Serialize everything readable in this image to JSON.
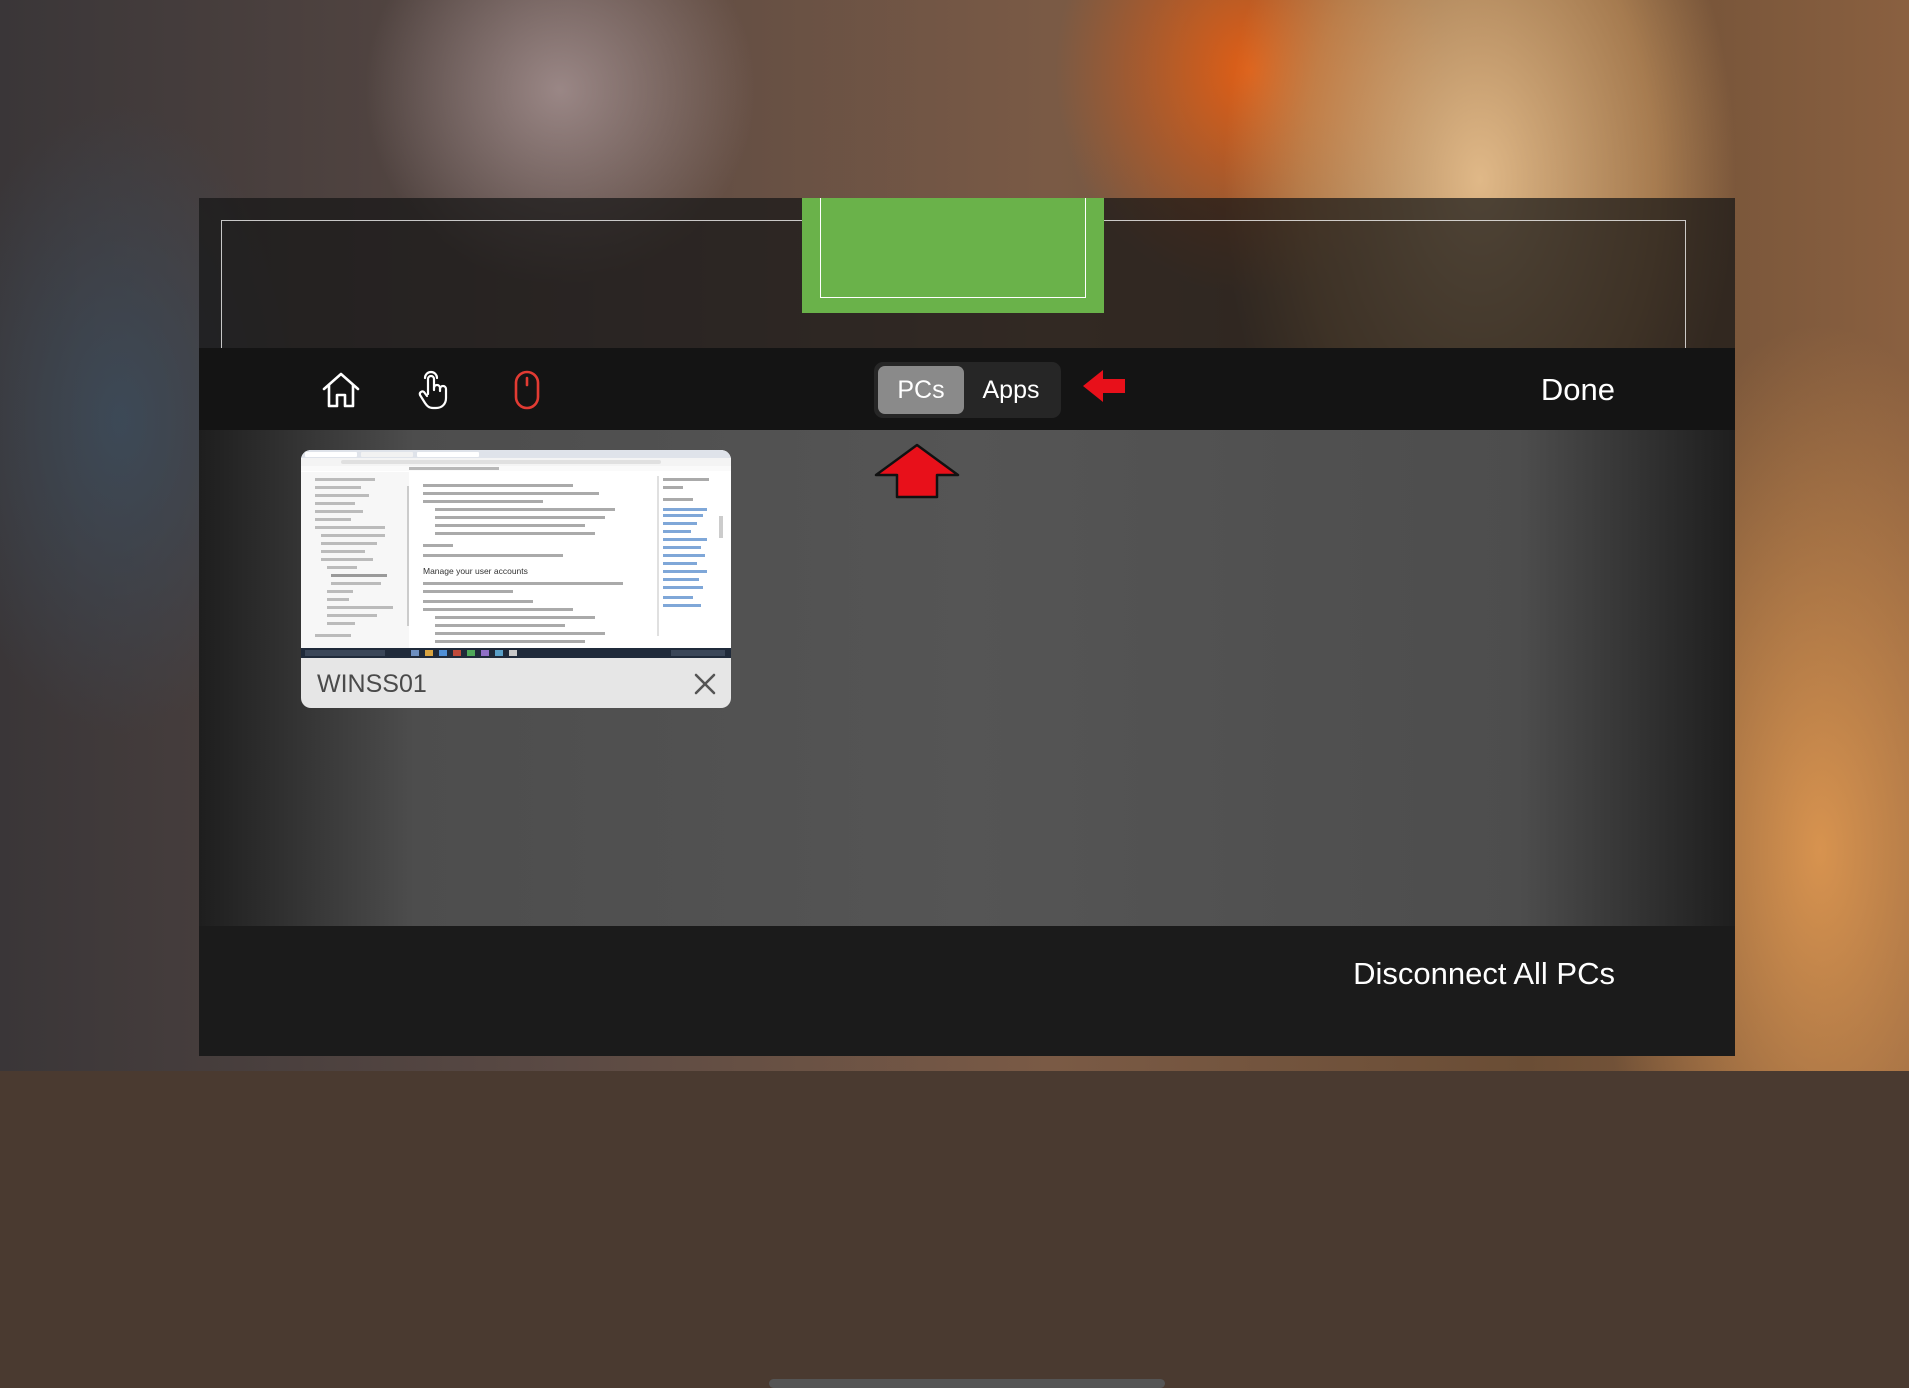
{
  "toolbar": {
    "icons": [
      "home-icon",
      "touch-icon",
      "mouse-icon"
    ],
    "segments": {
      "pcs_label": "PCs",
      "apps_label": "Apps",
      "selected": "PCs"
    },
    "done_label": "Done"
  },
  "pcs": [
    {
      "name": "WINSS01",
      "thumbnail_heading": "Manage your user accounts"
    }
  ],
  "footer": {
    "disconnect_label": "Disconnect All PCs"
  },
  "colors": {
    "accent_green": "#6ab24a",
    "annotation_red": "#e8101a",
    "selected_segment": "#8a8a8a",
    "toolbar_bg": "#141414"
  }
}
